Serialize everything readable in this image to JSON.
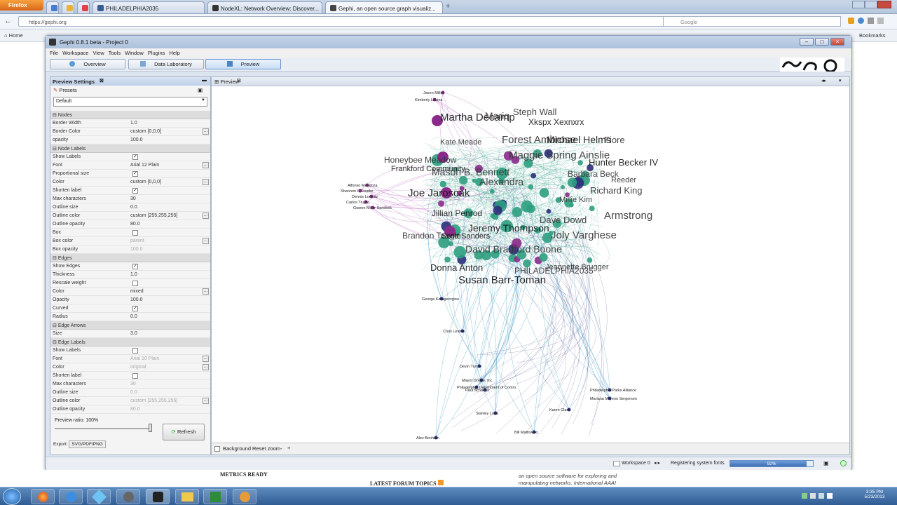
{
  "browser": {
    "firefox_label": "Firefox",
    "tabs": [
      {
        "label": "PHILADELPHIA2035",
        "active": false
      },
      {
        "label": "NodeXL: Network Overview: Discover...",
        "active": false
      },
      {
        "label": "Gephi, an open source graph visualiz...",
        "active": true
      }
    ],
    "url": "https://gephi.org",
    "search_placeholder": "Google",
    "bookmarks_home": "Home",
    "bookmarks_label": "Bookmarks"
  },
  "gephi": {
    "window_title": "Gephi 0.8.1 beta - Project 0",
    "menu": [
      "File",
      "Workspace",
      "View",
      "Tools",
      "Window",
      "Plugins",
      "Help"
    ],
    "modes": [
      "Overview",
      "Data Laboratory",
      "Preview"
    ],
    "active_mode": "Preview",
    "preview_settings": {
      "panel_title": "Preview Settings",
      "presets_label": "Presets",
      "preset_value": "Default",
      "rows": [
        {
          "type": "section",
          "label": "Nodes"
        },
        {
          "type": "prop",
          "label": "Border Width",
          "value": "1.0"
        },
        {
          "type": "prop",
          "label": "Border Color",
          "value": "custom [0,0,0]",
          "dots": true
        },
        {
          "type": "prop",
          "label": "opacity",
          "value": "100.0"
        },
        {
          "type": "section",
          "label": "Node Labels"
        },
        {
          "type": "check",
          "label": "Show Labels",
          "checked": true
        },
        {
          "type": "prop",
          "label": "Font",
          "value": "Arial 12 Plain",
          "dots": true
        },
        {
          "type": "check",
          "label": "Proportional size",
          "checked": true
        },
        {
          "type": "prop",
          "label": "Color",
          "value": "custom [0,0,0]",
          "dots": true
        },
        {
          "type": "check",
          "label": "Shorten label",
          "checked": true
        },
        {
          "type": "prop",
          "label": "Max characters",
          "value": "30"
        },
        {
          "type": "prop",
          "label": "Outline size",
          "value": "0.0"
        },
        {
          "type": "prop",
          "label": "Outline color",
          "value": "custom [255,255,255]",
          "dots": true
        },
        {
          "type": "prop",
          "label": "Outline opacity",
          "value": "80.0"
        },
        {
          "type": "check",
          "label": "Box",
          "checked": false
        },
        {
          "type": "prop",
          "label": "Box color",
          "value": "parent",
          "dots": true,
          "disabled": true
        },
        {
          "type": "prop",
          "label": "Box opacity",
          "value": "100.0",
          "disabled": true
        },
        {
          "type": "section",
          "label": "Edges"
        },
        {
          "type": "check",
          "label": "Show Edges",
          "checked": true
        },
        {
          "type": "prop",
          "label": "Thickness",
          "value": "1.0"
        },
        {
          "type": "check",
          "label": "Rescale weight",
          "checked": false
        },
        {
          "type": "prop",
          "label": "Color",
          "value": "mixed",
          "dots": true
        },
        {
          "type": "prop",
          "label": "Opacity",
          "value": "100.0"
        },
        {
          "type": "check",
          "label": "Curved",
          "checked": true
        },
        {
          "type": "prop",
          "label": "Radius",
          "value": "0.0"
        },
        {
          "type": "section",
          "label": "Edge Arrows"
        },
        {
          "type": "prop",
          "label": "Size",
          "value": "3.0"
        },
        {
          "type": "section",
          "label": "Edge Labels"
        },
        {
          "type": "check",
          "label": "Show Labels",
          "checked": false
        },
        {
          "type": "prop",
          "label": "Font",
          "value": "Arial 10 Plain",
          "dots": true,
          "disabled": true
        },
        {
          "type": "prop",
          "label": "Color",
          "value": "original",
          "dots": true,
          "disabled": true
        },
        {
          "type": "check",
          "label": "Shorten label",
          "checked": false
        },
        {
          "type": "prop",
          "label": "Max characters",
          "value": "30",
          "disabled": true
        },
        {
          "type": "prop",
          "label": "Outline size",
          "value": "0.0",
          "disabled": true
        },
        {
          "type": "prop",
          "label": "Outline color",
          "value": "custom [255,255,255]",
          "dots": true,
          "disabled": true
        },
        {
          "type": "prop",
          "label": "Outline opacity",
          "value": "80.0",
          "disabled": true
        }
      ],
      "preview_ratio_label": "Preview ratio:",
      "preview_ratio_value": "100%",
      "preview_ratio_fraction": 1.0,
      "export_label": "Export:",
      "export_button": "SVG/PDF/PNG",
      "refresh_button": "Refresh"
    },
    "preview_tab": "Preview",
    "background_label": "Background",
    "reset_zoom_label": "Reset zoom",
    "zoom_minus": "-",
    "zoom_plus": "+",
    "status": {
      "workspace": "Workspace 0",
      "task": "Registering system fonts",
      "progress_text": "92%",
      "progress_fraction": 0.92
    }
  },
  "graph": {
    "big_labels": [
      "Martha Decamp",
      "Mariq",
      "Steph Wall",
      "Xkspx Xexnxrx",
      "Kate Meade",
      "Forest Ambrose",
      "Michael Helms",
      "Fiore",
      "Honeybee Meadow",
      "Frankford Community",
      "Maggie Spring Ainslie",
      "Mason B. Bennett",
      "Hunter Becker IV",
      "Barbara Beck",
      "Reeder",
      "Joe Jaroscak",
      "Alexandra",
      "Richard King",
      "Jillian Penrod",
      "Millie Kim",
      "Armstrong",
      "Jeremy Thompson",
      "Dave Dowd",
      "Brandon Teagle",
      "Scott Sanders",
      "Joly Varghese",
      "David Bradford Boone",
      "Donna Anton",
      "PHILADELPHIA2035",
      "Jeannette Brugger",
      "Susan Barr-Toman"
    ],
    "small_labels": [
      "Jason Miller",
      "Kimberly Labina",
      "Alfonso Mendoza",
      "Shannon O'Rourke",
      "Dennis Lodwitz",
      "Carlos Trujillo",
      "Gwenn Miller Sandock",
      "George Karageorgiou",
      "Chris Levins",
      "Devin Turner",
      "Mayor Dodge, Inc.",
      "Philadelphia Department of Comm.",
      "Paul Schaefer",
      "Stanley Loya",
      "Philadelphia Parks Alliance",
      "Mariana Moreno Sergersen",
      "Karen Clark",
      "Bill Mattowski",
      "Alex Bonham"
    ]
  },
  "web_below": {
    "metrics": "METRICS READY",
    "forum": "LATEST FORUM TOPICS",
    "blurb1": "an open source software for exploring and",
    "blurb2": "manipulating networks. International AAAI"
  },
  "taskbar": {
    "time": "3:35 PM",
    "date": "5/23/2013"
  },
  "colors": {
    "teal": "#2e9e80",
    "purple": "#8a2a8a",
    "navy": "#2a2f7a",
    "blue_edge": "#5aa6c8",
    "pink_edge": "#c27ac6"
  }
}
